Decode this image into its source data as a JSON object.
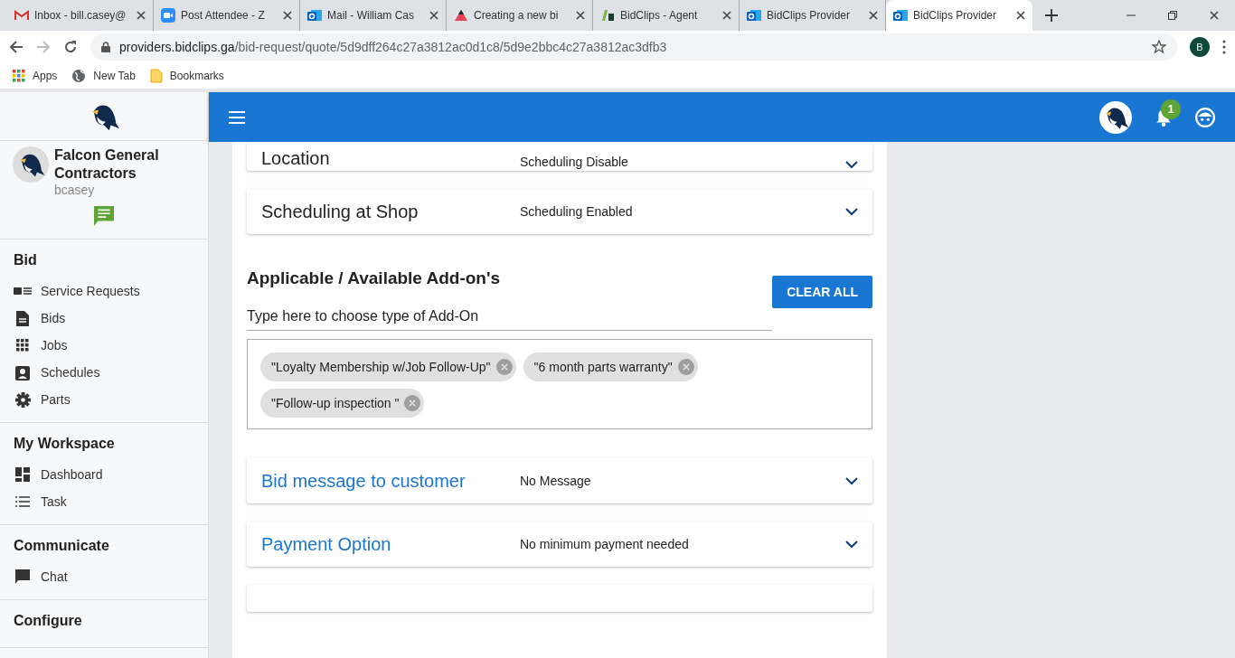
{
  "browser": {
    "tabs": [
      {
        "title": "Inbox - bill.casey@",
        "kind": "mail",
        "selected": false
      },
      {
        "title": "Post Attendee - Z",
        "kind": "video",
        "selected": false
      },
      {
        "title": "Mail - William Cas",
        "kind": "outlook",
        "selected": false
      },
      {
        "title": "Creating a new bi",
        "kind": "triangle",
        "selected": false
      },
      {
        "title": "BidClips - Agent",
        "kind": "clips",
        "selected": false
      },
      {
        "title": "BidClips Provider",
        "kind": "outlook",
        "selected": false
      },
      {
        "title": "BidClips Provider",
        "kind": "outlook",
        "selected": true
      }
    ],
    "url_host": "providers.bidclips.ga",
    "url_path": "/bid-request/quote/5d9dff264c27a3812ac0d1c8/5d9e2bbc4c27a3812ac3dfb3",
    "profile_initial": "B",
    "bookmarks": [
      {
        "label": "Apps",
        "kind": "apps"
      },
      {
        "label": "New Tab",
        "kind": "globe"
      },
      {
        "label": "Bookmarks",
        "kind": "folder"
      }
    ]
  },
  "sidebar": {
    "company": "Falcon General Contractors",
    "username": "bcasey",
    "sections": [
      {
        "title": "Bid",
        "items": [
          {
            "label": "Service Requests",
            "kind": "card"
          },
          {
            "label": "Bids",
            "kind": "doc"
          },
          {
            "label": "Jobs",
            "kind": "grid"
          },
          {
            "label": "Schedules",
            "kind": "contact"
          },
          {
            "label": "Parts",
            "kind": "gear"
          }
        ]
      },
      {
        "title": "My Workspace",
        "items": [
          {
            "label": "Dashboard",
            "kind": "dash"
          },
          {
            "label": "Task",
            "kind": "list"
          }
        ]
      },
      {
        "title": "Communicate",
        "items": [
          {
            "label": "Chat",
            "kind": "chat"
          }
        ]
      },
      {
        "title": "Configure"
      }
    ]
  },
  "appbar": {
    "notification_count": "1"
  },
  "main": {
    "top_panels": [
      {
        "title": "Location",
        "value": "Scheduling Disable",
        "kind": "plain"
      },
      {
        "title": "Scheduling at Shop",
        "value": "Scheduling Enabled",
        "kind": "plain"
      }
    ],
    "addons": {
      "heading": "Applicable / Available Add-on's",
      "placeholder": "Type here to choose type of Add-On",
      "clear_button": "CLEAR ALL",
      "chips": [
        "\"Loyalty Membership w/Job Follow-Up\"",
        "\"6 month parts warranty\"",
        "\"Follow-up inspection \""
      ]
    },
    "bottom_panels": [
      {
        "title": "Bid message to customer",
        "value": "No Message",
        "kind": "link"
      },
      {
        "title": "Payment Option",
        "value": "No minimum payment needed",
        "kind": "link"
      }
    ]
  }
}
